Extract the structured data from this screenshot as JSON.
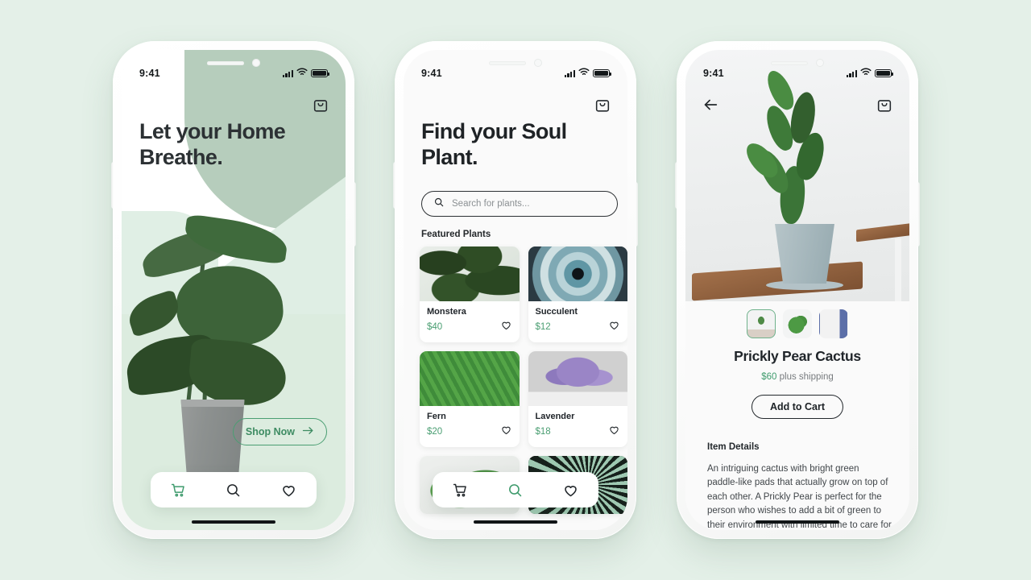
{
  "page": {
    "background_color": "#e4f0e8",
    "accent_green": "#4a9e72",
    "dark_text": "#20252a"
  },
  "status_bar": {
    "time": "9:41",
    "signal_icon": "cellular-signal-icon",
    "wifi_icon": "wifi-icon",
    "battery_icon": "battery-icon"
  },
  "phone1": {
    "screen_name": "onboarding-hero",
    "bag_icon": "shopping-bag-icon",
    "headline_line1": "Let your Home",
    "headline_line2": "Breathe.",
    "shop_now_label": "Shop Now",
    "shop_now_arrow_icon": "arrow-right-icon",
    "nav": [
      {
        "icon": "shopping-cart-icon",
        "active": true
      },
      {
        "icon": "search-icon",
        "active": false
      },
      {
        "icon": "heart-icon",
        "active": false
      }
    ]
  },
  "phone2": {
    "screen_name": "browse-plants",
    "bag_icon": "shopping-bag-icon",
    "headline_line1": "Find your Soul",
    "headline_line2": "Plant.",
    "search_placeholder": "Search for plants...",
    "search_icon": "search-icon",
    "section_label": "Featured Plants",
    "cards": [
      {
        "name": "Monstera",
        "price": "$40",
        "image": "monstera-leaves-photo",
        "favorite_icon": "heart-icon"
      },
      {
        "name": "Succulent",
        "price": "$12",
        "image": "succulent-rosette-photo",
        "favorite_icon": "heart-icon"
      },
      {
        "name": "Fern",
        "price": "$20",
        "image": "fern-fronds-photo",
        "favorite_icon": "heart-icon"
      },
      {
        "name": "Lavender",
        "price": "$18",
        "image": "lavender-pot-photo",
        "favorite_icon": "heart-icon"
      },
      {
        "name": "",
        "price": "",
        "image": "cactus-photo",
        "favorite_icon": "heart-icon"
      },
      {
        "name": "",
        "price": "",
        "image": "palm-leaf-photo",
        "favorite_icon": "heart-icon"
      }
    ],
    "nav": [
      {
        "icon": "shopping-cart-icon",
        "active": false
      },
      {
        "icon": "search-icon",
        "active": true
      },
      {
        "icon": "heart-icon",
        "active": false
      }
    ]
  },
  "phone3": {
    "screen_name": "product-detail",
    "back_icon": "arrow-left-icon",
    "bag_icon": "shopping-bag-icon",
    "hero_image": "prickly-pear-cactus-in-blue-pot-photo",
    "thumbnails": [
      {
        "image": "cactus-thumb-1",
        "selected": true
      },
      {
        "image": "cactus-thumb-2",
        "selected": false
      },
      {
        "image": "cactus-thumb-3",
        "selected": false
      }
    ],
    "product_title": "Prickly Pear Cactus",
    "price": "$60",
    "price_suffix": " plus shipping",
    "add_to_cart_label": "Add to Cart",
    "details_heading": "Item Details",
    "details_body": "An intriguing cactus with bright green paddle-like pads that actually grow on top of each other. A Prickly Pear is perfect for the person who wishes to add a bit of green to their environment with limited time to care for plants."
  }
}
